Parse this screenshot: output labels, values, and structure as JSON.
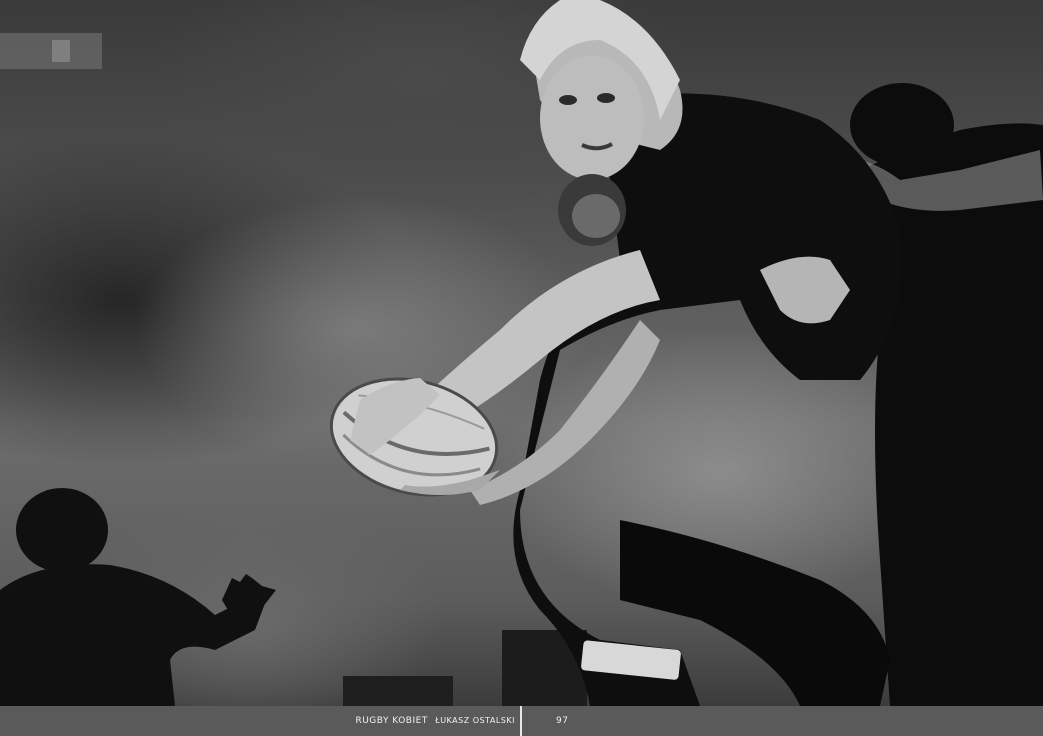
{
  "footer": {
    "magazine_title": "RUGBY KOBIET",
    "author": "Łukasz Ostalski",
    "page_number": "97"
  },
  "photo": {
    "subject": "womens-rugby-tackle",
    "tone": "black-and-white"
  }
}
